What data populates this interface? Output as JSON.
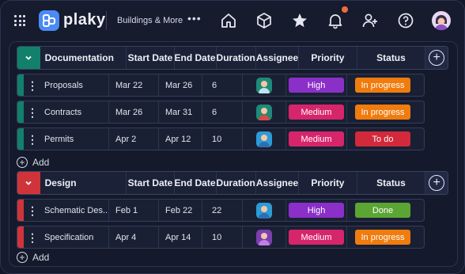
{
  "app": {
    "logo_text": "plaky",
    "workspace_name": "Buildings & More",
    "more_glyph": "•••"
  },
  "toolbar_icons": [
    "home-icon",
    "box-icon",
    "star-icon",
    "bell-icon",
    "add-user-icon",
    "help-icon"
  ],
  "colors": {
    "documentation_group": "#12806b",
    "design_group": "#d0343a",
    "priority_high": "#8b2fc9",
    "priority_medium": "#d6256b",
    "status_in_progress": "#f07c0e",
    "status_to_do": "#d2293b",
    "status_done": "#5ba534"
  },
  "groups": [
    {
      "name": "Documentation",
      "columns": {
        "start": "Start Date",
        "end": "End Date",
        "duration": "Duration",
        "assignee": "Assignee",
        "priority": "Priority",
        "status": "Status"
      },
      "rows": [
        {
          "name": "Proposals",
          "start": "Mar 22",
          "end": "Mar 26",
          "duration": "6",
          "priority": "High",
          "status": "In progress"
        },
        {
          "name": "Contracts",
          "start": "Mar 26",
          "end": "Mar 31",
          "duration": "6",
          "priority": "Medium",
          "status": "In progress"
        },
        {
          "name": "Permits",
          "start": "Apr 2",
          "end": "Apr 12",
          "duration": "10",
          "priority": "Medium",
          "status": "To do"
        }
      ],
      "add_label": "Add"
    },
    {
      "name": "Design",
      "columns": {
        "start": "Start Date",
        "end": "End Date",
        "duration": "Duration",
        "assignee": "Assignee",
        "priority": "Priority",
        "status": "Status"
      },
      "rows": [
        {
          "name": "Schematic Des...",
          "start": "Feb 1",
          "end": "Feb 22",
          "duration": "22",
          "priority": "High",
          "status": "Done"
        },
        {
          "name": "Specification",
          "start": "Apr 4",
          "end": "Apr 14",
          "duration": "10",
          "priority": "Medium",
          "status": "In progress"
        }
      ],
      "add_label": "Add"
    }
  ]
}
